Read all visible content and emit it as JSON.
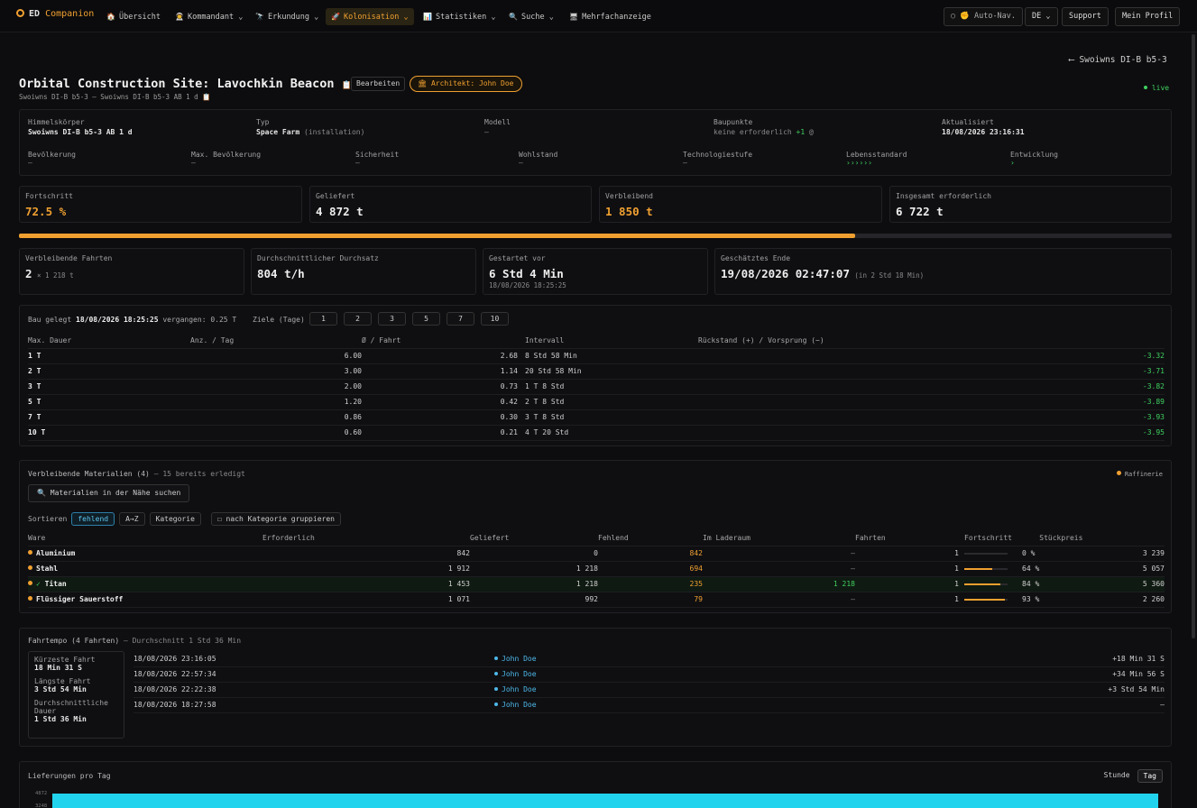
{
  "nav": {
    "brand_prefix": "ED",
    "brand_name": "Companion",
    "items": [
      {
        "label": "Übersicht",
        "icon": "🏠"
      },
      {
        "label": "Kommandant",
        "icon": "👨‍🚀"
      },
      {
        "label": "Erkundung",
        "icon": "🔭"
      },
      {
        "label": "Kolonisation",
        "icon": "🚀"
      },
      {
        "label": "Statistiken",
        "icon": "📊"
      },
      {
        "label": "Suche",
        "icon": "🔍"
      },
      {
        "label": "Mehrfachanzeige",
        "icon": "🖥"
      }
    ],
    "autonav": "Auto-Nav.",
    "lang": "DE",
    "support": "Support",
    "profile": "Mein Profil"
  },
  "back_link": "⟵ Swoiwns DI-B b5-3",
  "header": {
    "title": "Orbital Construction Site: Lavochkin Beacon",
    "edit": "Bearbeiten",
    "architect": "Architekt: John Doe",
    "subtitle": "Swoiwns DI-B b5-3 – Swoiwns DI-B b5-3 AB 1 d",
    "live": "live"
  },
  "info": {
    "row1": [
      {
        "label": "Himmelskörper",
        "value": "Swoiwns DI-B b5-3 AB 1 d",
        "extra": ""
      },
      {
        "label": "Typ",
        "value": "Space Farm",
        "extra": "(installation)"
      },
      {
        "label": "Modell",
        "value": "–",
        "extra": ""
      },
      {
        "label": "Baupunkte",
        "value": "keine erforderlich",
        "extra": "+1"
      },
      {
        "label": "Aktualisiert",
        "value": "18/08/2026 23:16:31",
        "extra": ""
      }
    ],
    "row2": [
      {
        "label": "Bevölkerung",
        "value": "–"
      },
      {
        "label": "Max. Bevölkerung",
        "value": "–"
      },
      {
        "label": "Sicherheit",
        "value": "–"
      },
      {
        "label": "Wohlstand",
        "value": "–"
      },
      {
        "label": "Technologiestufe",
        "value": "–"
      },
      {
        "label": "Lebensstandard",
        "value": "››››››"
      },
      {
        "label": "Entwicklung",
        "value": "›"
      }
    ]
  },
  "stats": [
    {
      "label": "Fortschritt",
      "value": "72.5 %"
    },
    {
      "label": "Geliefert",
      "value": "4 872 t"
    },
    {
      "label": "Verbleibend",
      "value": "1 850 t"
    },
    {
      "label": "Insgesamt erforderlich",
      "value": "6 722 t"
    }
  ],
  "progress": 0.725,
  "stats2": [
    {
      "label": "Verbleibende Fahrten",
      "value": "2",
      "extra": "× 1 218 t",
      "sub": ""
    },
    {
      "label": "Durchschnittlicher Durchsatz",
      "value": "804 t/h",
      "extra": "",
      "sub": ""
    },
    {
      "label": "Gestartet vor",
      "value": "6 Std 4 Min",
      "extra": "",
      "sub": "18/08/2026 18:25:25"
    },
    {
      "label": "Geschätztes Ende",
      "value": "19/08/2026 02:47:07",
      "extra": "(in 2 Std 18 Min)",
      "sub": ""
    }
  ],
  "targets": {
    "built_label": "Bau gelegt",
    "built_value": "18/08/2026 18:25:25",
    "elapsed": "vergangen: 0.25 T",
    "goals_label": "Ziele (Tage)",
    "goals": [
      "1",
      "2",
      "3",
      "5",
      "7",
      "10"
    ],
    "headers": [
      "Max. Dauer",
      "Anz. / Tag",
      "Ø / Fahrt",
      "Intervall",
      "Rückstand (+) / Vorsprung (−)"
    ],
    "rows": [
      [
        "1 T",
        "6.00",
        "2.68",
        "8 Std 58 Min",
        "-3.32"
      ],
      [
        "2 T",
        "3.00",
        "1.14",
        "20 Std 58 Min",
        "-3.71"
      ],
      [
        "3 T",
        "2.00",
        "0.73",
        "1 T 8 Std",
        "-3.82"
      ],
      [
        "5 T",
        "1.20",
        "0.42",
        "2 T 8 Std",
        "-3.89"
      ],
      [
        "7 T",
        "0.86",
        "0.30",
        "3 T 8 Std",
        "-3.93"
      ],
      [
        "10 T",
        "0.60",
        "0.21",
        "4 T 20 Std",
        "-3.95"
      ]
    ]
  },
  "materials": {
    "title": "Verbleibende Materialien (4)",
    "done": "– 15 bereits erledigt",
    "legend": "Raffinerie",
    "search_btn": "Materialien in der Nähe suchen",
    "sort_label": "Sortieren",
    "sort_opts": [
      "fehlend",
      "A→Z",
      "Kategorie"
    ],
    "group_btn": "nach Kategorie gruppieren",
    "headers": [
      "Ware",
      "Erforderlich",
      "Geliefert",
      "Fehlend",
      "Im Laderaum",
      "Fahrten",
      "Fortschritt",
      "Stückpreis"
    ],
    "rows": [
      {
        "name": "Aluminium",
        "check": "",
        "req": "842",
        "del": "0",
        "miss": "842",
        "cargo": "–",
        "trips": "1",
        "pct": 0,
        "pct_label": "0 %",
        "price": "3 239"
      },
      {
        "name": "Stahl",
        "check": "",
        "req": "1 912",
        "del": "1 218",
        "miss": "694",
        "cargo": "–",
        "trips": "1",
        "pct": 0.64,
        "pct_label": "64 %",
        "price": "5 057"
      },
      {
        "name": "Titan",
        "check": "✓",
        "req": "1 453",
        "del": "1 218",
        "miss": "235",
        "cargo": "1 218",
        "trips": "1",
        "pct": 0.84,
        "pct_label": "84 %",
        "price": "5 360"
      },
      {
        "name": "Flüssiger Sauerstoff",
        "check": "",
        "req": "1 071",
        "del": "992",
        "miss": "79",
        "cargo": "–",
        "trips": "1",
        "pct": 0.93,
        "pct_label": "93 %",
        "price": "2 260"
      }
    ]
  },
  "pace": {
    "title": "Fahrtempo (4 Fahrten)",
    "avg": "– Durchschnitt 1 Std 36 Min",
    "summary": [
      {
        "label": "Kürzeste Fahrt",
        "value": "18 Min 31 S"
      },
      {
        "label": "Längste Fahrt",
        "value": "3 Std 54 Min"
      },
      {
        "label": "Durchschnittliche Dauer",
        "value": "1 Std 36 Min"
      }
    ],
    "rows": [
      {
        "time": "18/08/2026 23:16:05",
        "user": "John Doe",
        "delta": "+18 Min 31 S"
      },
      {
        "time": "18/08/2026 22:57:34",
        "user": "John Doe",
        "delta": "+34 Min 56 S"
      },
      {
        "time": "18/08/2026 22:22:38",
        "user": "John Doe",
        "delta": "+3 Std 54 Min"
      },
      {
        "time": "18/08/2026 18:27:58",
        "user": "John Doe",
        "delta": "–"
      }
    ]
  },
  "deliveries": {
    "title": "Lieferungen pro Tag",
    "toggle": [
      "Stunde",
      "Tag"
    ],
    "ticks": [
      "4872",
      "3248"
    ]
  },
  "colors": {
    "accent": "#f0a030",
    "cyan": "#22d3ee",
    "green": "#3fcf5e"
  }
}
